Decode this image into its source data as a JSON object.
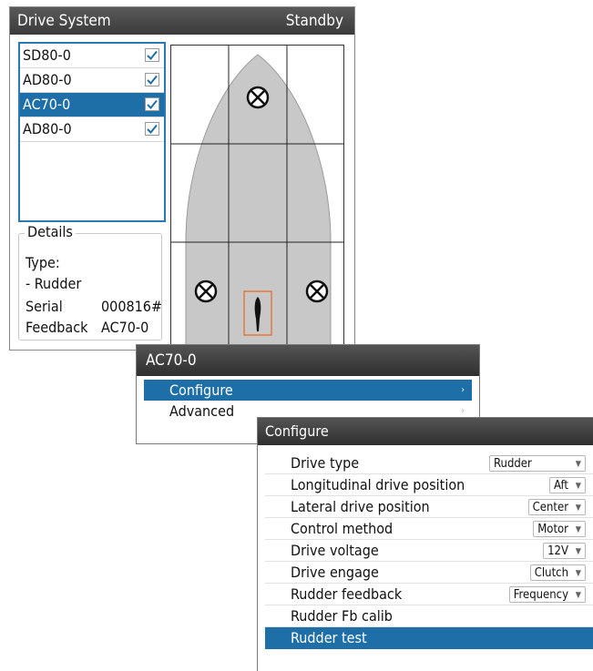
{
  "drive_window": {
    "title": "Drive System",
    "status": "Standby",
    "drives": [
      {
        "name": "SD80-0",
        "checked": true,
        "selected": false
      },
      {
        "name": "AD80-0",
        "checked": true,
        "selected": false
      },
      {
        "name": "AC70-0",
        "checked": true,
        "selected": true
      },
      {
        "name": "AD80-0",
        "checked": true,
        "selected": false
      }
    ],
    "details": {
      "legend": "Details",
      "type_label": "Type:",
      "type_value": "- Rudder",
      "serial_label": "Serial",
      "serial_value": "000816#",
      "feedback_label": "Feedback",
      "feedback_value": "AC70-0"
    }
  },
  "ac_menu": {
    "title": "AC70-0",
    "items": [
      {
        "label": "Configure",
        "arrow": "›",
        "selected": true
      },
      {
        "label": "Advanced",
        "arrow": "›",
        "selected": false
      }
    ]
  },
  "configure": {
    "title": "Configure",
    "rows": [
      {
        "label": "Drive type",
        "value": "Rudder"
      },
      {
        "label": "Longitudinal drive position",
        "value": "Aft"
      },
      {
        "label": "Lateral drive position",
        "value": "Center"
      },
      {
        "label": "Control method",
        "value": "Motor"
      },
      {
        "label": "Drive voltage",
        "value": "12V"
      },
      {
        "label": "Drive engage",
        "value": "Clutch"
      },
      {
        "label": "Rudder feedback",
        "value": "Frequency"
      },
      {
        "label": "Rudder Fb calib",
        "value": null
      },
      {
        "label": "Rudder test",
        "value": null,
        "selected": true
      }
    ]
  },
  "icons": {
    "checkbox": "checkmark-icon",
    "drive_marker": "drive-position-icon",
    "rudder": "rudder-icon",
    "dropdown": "caret-down-icon"
  },
  "colors": {
    "selection": "#1e6fa8",
    "titlebar": "#3a3a3a",
    "hull": "#c8c8c8",
    "rudder_highlight": "#e07a40"
  }
}
